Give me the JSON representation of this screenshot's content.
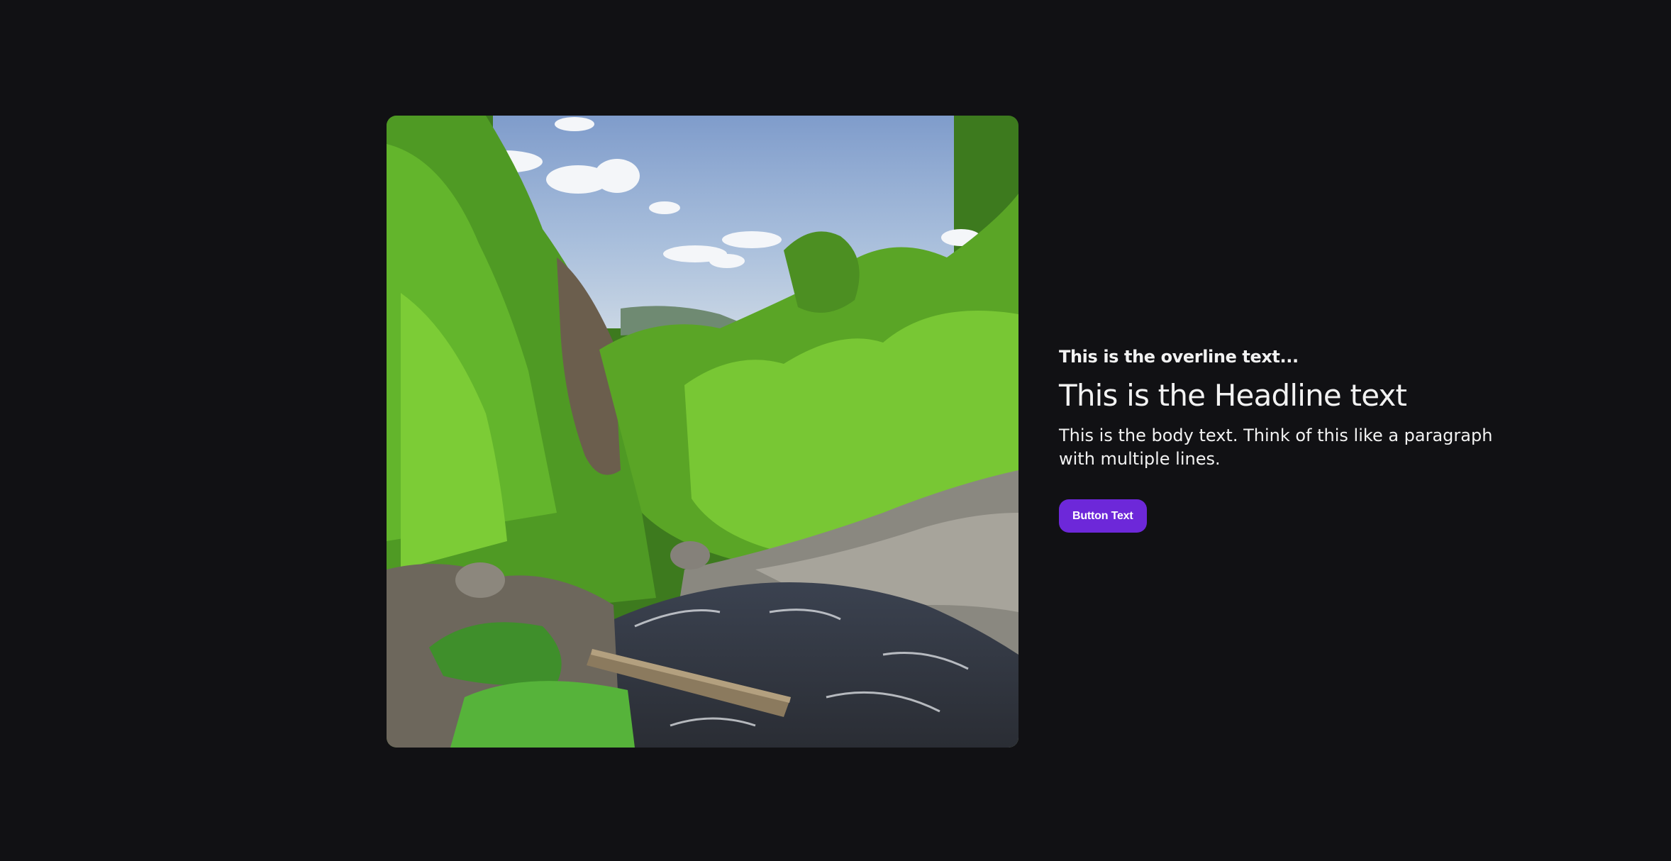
{
  "page": {
    "background": "#111114"
  },
  "hero": {
    "image_icon": "forest-waterfall-photo-icon",
    "overline": "This is the overline text...",
    "headline": "This is the Headline text",
    "body": "This is the body text. Think of this like a paragraph with multiple lines.",
    "button_label": "Button Text",
    "button_color": "#6d28d9"
  }
}
